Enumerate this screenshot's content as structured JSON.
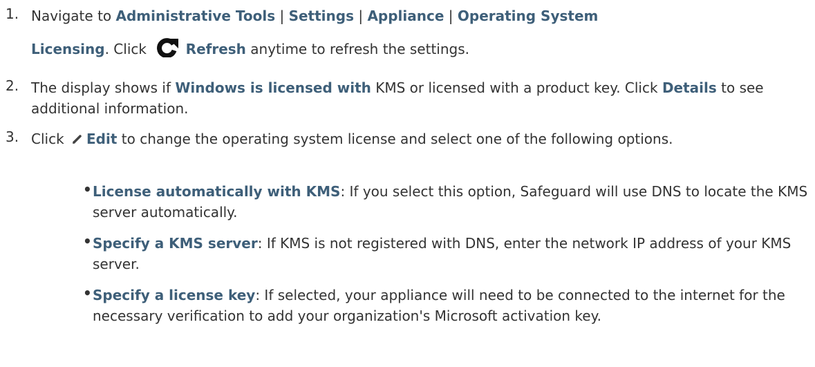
{
  "steps": [
    {
      "number": "1.",
      "line1": {
        "t1": "Navigate to ",
        "b1": "Administrative Tools",
        "sep1": " | ",
        "b2": "Settings",
        "sep2": " | ",
        "b3": "Appliance",
        "sep3": " | ",
        "b4": "Operating System"
      },
      "line2": {
        "b5": "Licensing",
        "t2": ". Click ",
        "icon": "refresh-icon",
        "b6": "Refresh",
        "t3": " anytime to refresh the settings."
      }
    },
    {
      "number": "2.",
      "t1": "The display shows if ",
      "b1": "Windows is licensed with",
      "t2": " KMS or licensed with a product key. Click ",
      "b2": "Details",
      "t3": " to see additional information."
    },
    {
      "number": "3.",
      "t1": "Click ",
      "icon": "pencil-icon",
      "b1": "Edit",
      "t2": " to change the operating system license and select one of the following options."
    }
  ],
  "options": [
    {
      "bullet": "•",
      "label": "License automatically with KMS",
      "text": ": If you select this option, Safeguard will use DNS to locate the KMS server automatically."
    },
    {
      "bullet": "•",
      "label": "Specify a KMS server",
      "text": ": If KMS is not registered with DNS, enter the network IP address of your KMS server."
    },
    {
      "bullet": "•",
      "label": "Specify a license key",
      "text": ": If selected, your appliance will need to be connected to the internet for the necessary verification to add your organization's Microsoft activation key."
    }
  ],
  "colors": {
    "bold_text": "#3e5f79",
    "body_text": "#333333"
  }
}
